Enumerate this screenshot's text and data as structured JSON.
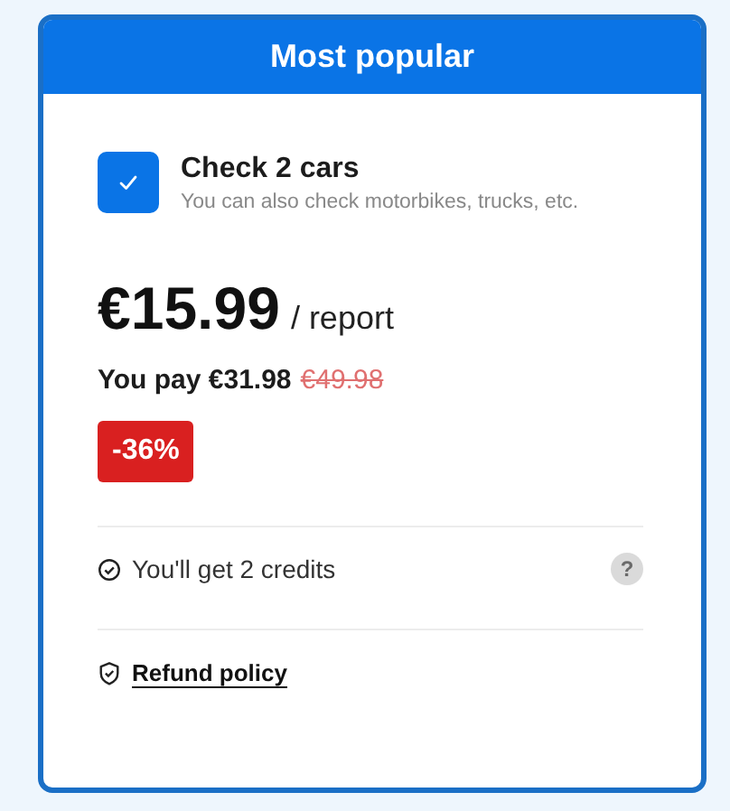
{
  "header": {
    "title": "Most popular"
  },
  "option": {
    "checked": true,
    "title": "Check 2 cars",
    "subtitle": "You can also check motorbikes, trucks, etc."
  },
  "price": {
    "amount": "€15.99",
    "unit": "/ report",
    "you_pay": "You pay €31.98",
    "old_price": "€49.98",
    "discount": "-36%"
  },
  "features": [
    {
      "text": "You'll get 2 credits",
      "help": "?"
    }
  ],
  "refund": {
    "label": "Refund policy"
  }
}
